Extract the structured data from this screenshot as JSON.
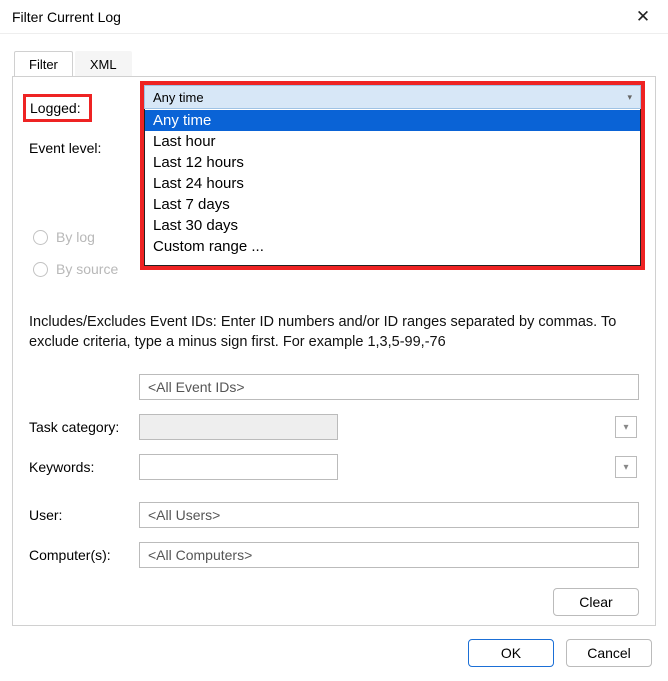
{
  "window": {
    "title": "Filter Current Log"
  },
  "tabs": {
    "filter": "Filter",
    "xml": "XML"
  },
  "labels": {
    "logged": "Logged:",
    "event_level": "Event level:",
    "by_log": "By log",
    "by_source": "By source",
    "task_category": "Task category:",
    "keywords": "Keywords:",
    "user": "User:",
    "computers": "Computer(s):"
  },
  "dropdown": {
    "selected": "Any time",
    "items": [
      "Any time",
      "Last hour",
      "Last 12 hours",
      "Last 24 hours",
      "Last 7 days",
      "Last 30 days",
      "Custom range ..."
    ]
  },
  "help_text": "Includes/Excludes Event IDs: Enter ID numbers and/or ID ranges separated by commas. To exclude criteria, type a minus sign first. For example 1,3,5-99,-76",
  "fields": {
    "event_ids": "<All Event IDs>",
    "task_category": "",
    "keywords": "",
    "user": "<All Users>",
    "computers": "<All Computers>"
  },
  "buttons": {
    "clear": "Clear",
    "ok": "OK",
    "cancel": "Cancel"
  }
}
